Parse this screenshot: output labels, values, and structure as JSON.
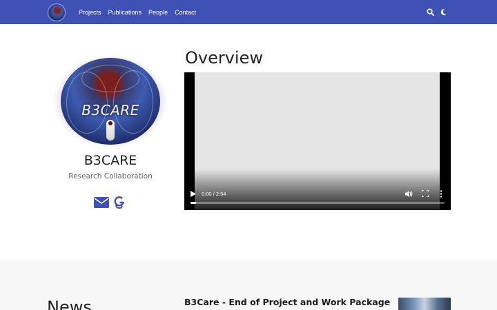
{
  "navbar": {
    "links": [
      "Projects",
      "Publications",
      "People",
      "Contact"
    ],
    "icons": [
      "search-icon",
      "moon-icon"
    ],
    "background": "#3f51b5"
  },
  "profile": {
    "avatar_text": "B3CARE",
    "name": "B3CARE",
    "role": "Research Collaboration",
    "social_icons": [
      "envelope-icon",
      "google-scholar-icon"
    ],
    "accent": "#3f51b5"
  },
  "overview": {
    "title": "Overview",
    "video": {
      "time": "0:00 / 2:54",
      "progress": 0.0
    }
  },
  "news": {
    "heading": "News",
    "first_item_title": "B3Care - End of Project and Work Package"
  }
}
